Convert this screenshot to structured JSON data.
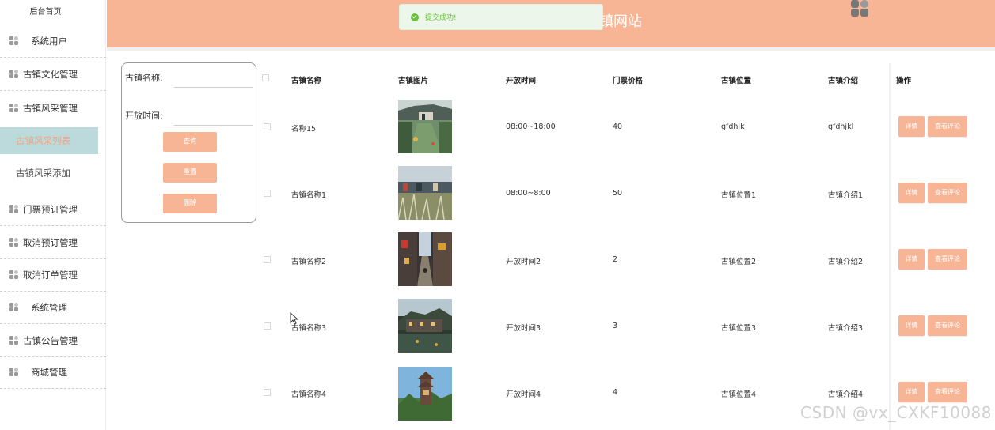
{
  "header": {
    "title": "镇网站"
  },
  "toast": {
    "message": "提交成功!"
  },
  "sidebar": {
    "home": "后台首页",
    "items": [
      {
        "label": "系统用户",
        "icon": "grid-icon"
      },
      {
        "label": "古镇文化管理",
        "icon": "grid-icon"
      },
      {
        "label": "古镇风采管理",
        "icon": "grid-icon"
      },
      {
        "label": "古镇风采列表",
        "sub": true,
        "active": true
      },
      {
        "label": "古镇风采添加",
        "sub": true
      },
      {
        "label": "门票预订管理",
        "icon": "grid-icon"
      },
      {
        "label": "取消预订管理",
        "icon": "grid-icon"
      },
      {
        "label": "取消订单管理",
        "icon": "grid-icon"
      },
      {
        "label": "系统管理",
        "icon": "grid-icon"
      },
      {
        "label": "古镇公告管理",
        "icon": "grid-icon"
      },
      {
        "label": "商城管理",
        "icon": "grid-icon"
      }
    ]
  },
  "search": {
    "name_label": "古镇名称:",
    "time_label": "开放时间:",
    "query_btn": "查询",
    "reset_btn": "重置",
    "delete_btn": "删除"
  },
  "table": {
    "headers": [
      "古镇名称",
      "古镇图片",
      "开放时间",
      "门票价格",
      "古镇位置",
      "古镇介绍",
      "操作"
    ],
    "detail_btn": "详情",
    "comment_btn": "查看评论",
    "rows": [
      {
        "name": "名称15",
        "time": "08:00~18:00",
        "price": "40",
        "location": "gfdhjk",
        "intro": "gfdhjkl"
      },
      {
        "name": "古镇名称1",
        "time": "08:00~8:00",
        "price": "50",
        "location": "古镇位置1",
        "intro": "古镇介绍1"
      },
      {
        "name": "古镇名称2",
        "time": "开放时间2",
        "price": "2",
        "location": "古镇位置2",
        "intro": "古镇介绍2"
      },
      {
        "name": "古镇名称3",
        "time": "开放时间3",
        "price": "3",
        "location": "古镇位置3",
        "intro": "古镇介绍3"
      },
      {
        "name": "古镇名称4",
        "time": "开放时间4",
        "price": "4",
        "location": "古镇位置4",
        "intro": "古镇介绍4"
      }
    ]
  },
  "watermark": "CSDN @vx_CXKF10088",
  "colors": {
    "accent": "#f8b595",
    "active_bg": "#bcdadb",
    "success": "#67c23a"
  }
}
